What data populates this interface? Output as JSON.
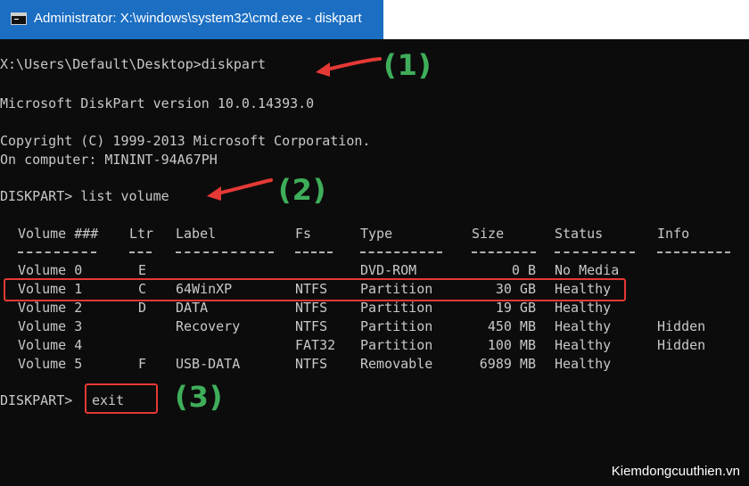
{
  "window": {
    "title": "Administrator: X:\\windows\\system32\\cmd.exe - diskpart",
    "icon": "cmd-icon"
  },
  "console": {
    "prompt_line": "X:\\Users\\Default\\Desktop>diskpart",
    "version_line": "Microsoft DiskPart version 10.0.14393.0",
    "copyright_line": "Copyright (C) 1999-2013 Microsoft Corporation.",
    "computer_line": "On computer: MININT-94A67PH",
    "list_command_line": "DISKPART> list volume",
    "exit_prompt": "DISKPART>",
    "exit_command": "exit"
  },
  "volume_table": {
    "headers": [
      "Volume ###",
      "Ltr",
      "Label",
      "Fs",
      "Type",
      "Size",
      "Status",
      "Info"
    ],
    "rows": [
      [
        "Volume 0",
        "E",
        "",
        "",
        "DVD-ROM",
        "0 B",
        "No Media",
        ""
      ],
      [
        "Volume 1",
        "C",
        "64WinXP",
        "NTFS",
        "Partition",
        "30 GB",
        "Healthy",
        ""
      ],
      [
        "Volume 2",
        "D",
        "DATA",
        "NTFS",
        "Partition",
        "19 GB",
        "Healthy",
        ""
      ],
      [
        "Volume 3",
        "",
        "Recovery",
        "NTFS",
        "Partition",
        "450 MB",
        "Healthy",
        "Hidden"
      ],
      [
        "Volume 4",
        "",
        "",
        "FAT32",
        "Partition",
        "100 MB",
        "Healthy",
        "Hidden"
      ],
      [
        "Volume 5",
        "F",
        "USB-DATA",
        "NTFS",
        "Removable",
        "6989 MB",
        "Healthy",
        ""
      ]
    ],
    "highlighted_row": 1
  },
  "annotations": {
    "step1": "(1)",
    "step2": "(2)",
    "step3": "(3)",
    "callout_color": "#3fae5a",
    "arrow_color": "#e53935"
  },
  "watermark": "Kiemdongcuuthien.vn"
}
